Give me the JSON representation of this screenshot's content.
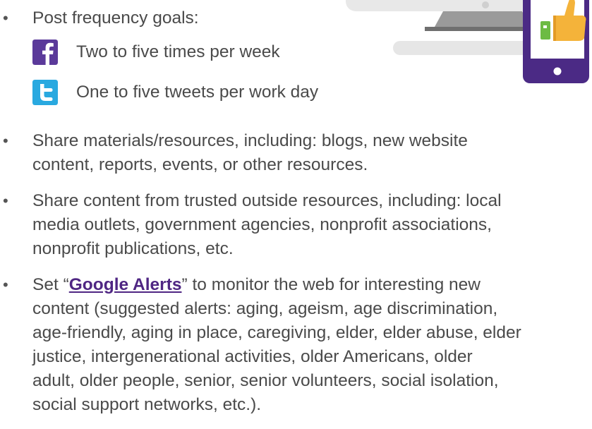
{
  "post_frequency": {
    "heading": "Post frequency goals:",
    "items": [
      {
        "icon": "facebook-icon",
        "color": "#5b3a9a",
        "text": "Two to five times per week"
      },
      {
        "icon": "twitter-icon",
        "color": "#29a9e0",
        "text": "One to five tweets per work day"
      }
    ]
  },
  "bullets": {
    "share_materials": {
      "line1": "Share materials/resources, including: blogs, new website",
      "line2": "content, reports, events, or other resources."
    },
    "share_content": {
      "line1": "Share content from trusted outside resources, including: local",
      "line2": "media outlets, government agencies, nonprofit associations,",
      "line3": "nonprofit publications, etc."
    },
    "google_alerts": {
      "prefix": "Set “",
      "link_text": "Google Alerts",
      "suffix_line1": "” to monitor the web for interesting new",
      "line2": "content (suggested alerts: aging, ageism, age discrimination,",
      "line3": "age-friendly, aging in place, caregiving, elder, elder abuse, elder",
      "line4": "justice, intergenerational activities, older Americans, older",
      "line5": "adult, older people, senior, senior volunteers, social isolation,",
      "line6": "social support networks, etc.)."
    }
  },
  "colors": {
    "text": "#4a4a4a",
    "link": "#4f2683",
    "phone_frame": "#4b2a85",
    "thumbs_up": "#f4b33a",
    "cuff": "#6dbb43",
    "monitor": "#e6e6e6"
  },
  "illustration": {
    "icons": [
      "computer-monitor-icon",
      "smartphone-icon",
      "thumbs-up-icon"
    ]
  }
}
